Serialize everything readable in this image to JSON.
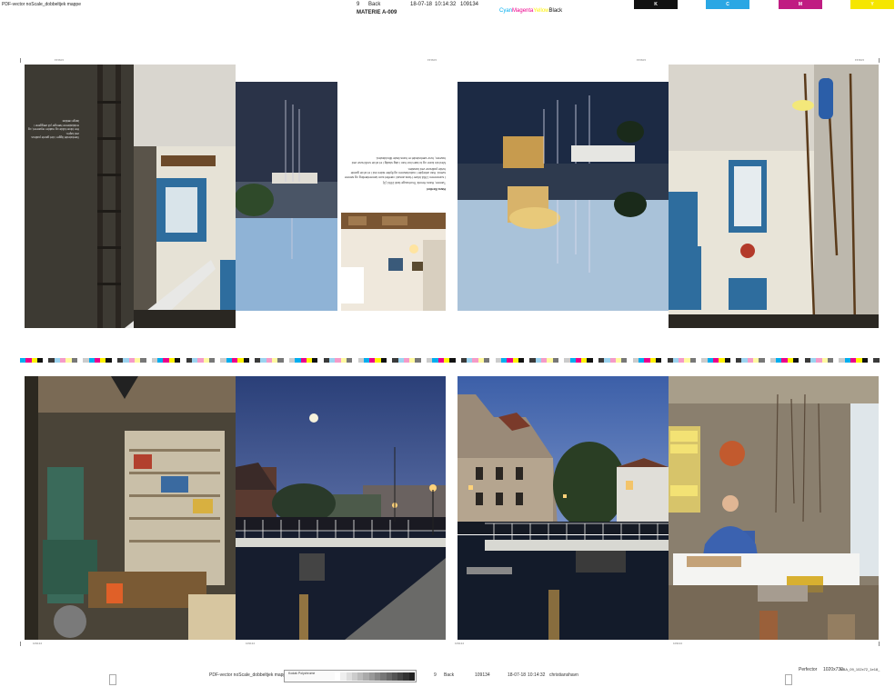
{
  "header": {
    "file_name": "PDF-vector noScale_dobbeltjek mappe",
    "page_number": "9",
    "side": "Back",
    "date": "18-07-18",
    "time": "10:14:32",
    "job_number": "109134",
    "materie": "MATERIE A-009",
    "inks": {
      "cyan": "Cyan",
      "magenta": "Magenta",
      "yellow": "Yellow",
      "black": "Black"
    },
    "patches": {
      "k": "K",
      "c": "C",
      "m": "M",
      "y": "Y"
    }
  },
  "spread_top": {
    "text_block": {
      "heading": "Hans Berthel",
      "paragraphs": [
        "Tømrer, Hans Henrik Thorhauge født 1954 (3)",
        "I sommeren 1964 bliver Hans ansat i værftet som tømrerlærling og senere svend. Han arbejder i nabohavnen og flytter siden ind i et af de gamle hvide pakhuse ved kanalen.",
        "Med sin kone og to børn bor han i dag stadig i et af de små huse ved havnen, hvor værkstedet er hans faste tilholdssted."
      ]
    },
    "side_note": [
      "Værkstedet ligger i det gamle pakhus ved kajen.",
      "Her bliver både og møbler repareret, og redskaberne hænger på væggene i lange rækker."
    ]
  },
  "colors": {
    "sky_dusk": "#2c3e66",
    "sky_day": "#7aa6cf",
    "water": "#1b2433",
    "light_warm": "#f2c26b",
    "wall_white": "#e8e4d8",
    "wood": "#8a5a33",
    "door_blue": "#2e6d9e"
  },
  "footer": {
    "file_name": "PDF-vector noScale_dobbeltjek mappe",
    "kodak_label": "Kodak Polychrome",
    "page_number": "9",
    "side": "Back",
    "job_number": "109134",
    "date": "18-07-18",
    "time": "10:14:32",
    "place": "christianshavn",
    "plate": "Perfector",
    "format": "1020x730",
    "spec": "KBA_09_102x72_1e18_"
  }
}
